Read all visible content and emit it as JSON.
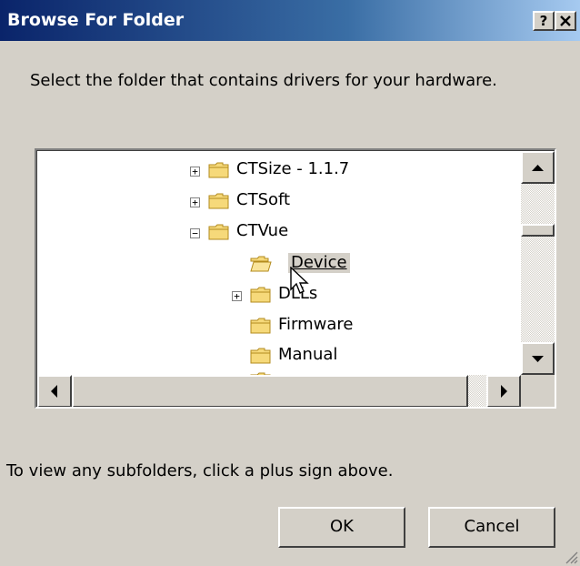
{
  "window": {
    "title": "Browse For Folder",
    "help_button": "?",
    "close_button": "x"
  },
  "instruction": "Select the folder that contains drivers for your hardware.",
  "tree": {
    "items": [
      {
        "label": "CTSize - 1.1.7",
        "expander": "+",
        "selected": false
      },
      {
        "label": "CTSoft",
        "expander": "+",
        "selected": false
      },
      {
        "label": "CTVue",
        "expander": "−",
        "selected": false
      },
      {
        "label": "Device",
        "expander": "",
        "selected": true
      },
      {
        "label": "DLLs",
        "expander": "+",
        "selected": false
      },
      {
        "label": "Firmware",
        "expander": "",
        "selected": false
      },
      {
        "label": "Manual",
        "expander": "",
        "selected": false
      }
    ]
  },
  "hint": "To view any subfolders, click a plus sign above.",
  "buttons": {
    "ok": "OK",
    "cancel": "Cancel"
  },
  "colors": {
    "title_gradient_start": "#0a246a",
    "title_gradient_end": "#a6caf0",
    "folder_fill": "#f6d97a",
    "dialog_bg": "#d4d0c8"
  }
}
